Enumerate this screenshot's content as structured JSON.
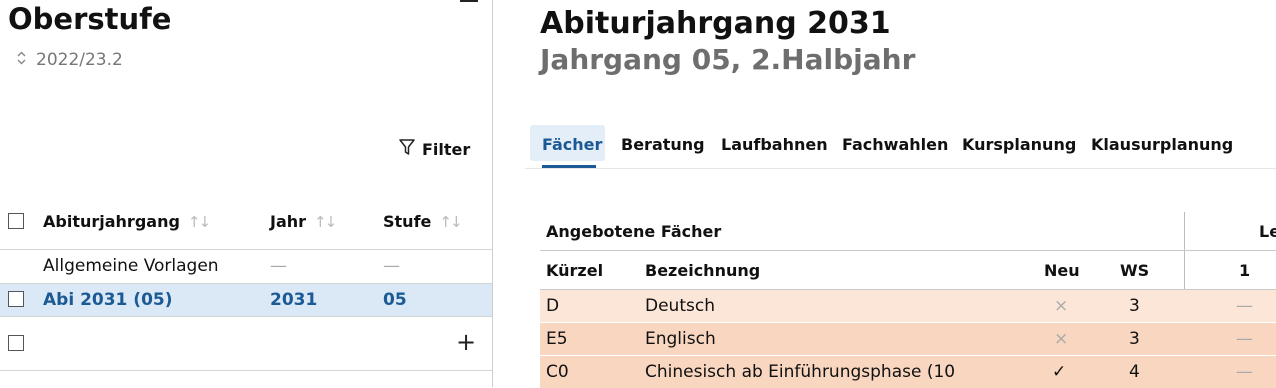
{
  "sidebar": {
    "title": "Oberstufe",
    "term": "2022/23.2",
    "filter_label": "Filter",
    "columns": {
      "abiturjahrgang": "Abiturjahrgang",
      "jahr": "Jahr",
      "stufe": "Stufe"
    },
    "rows": [
      {
        "name": "Allgemeine Vorlagen",
        "jahr": "—",
        "stufe": "—"
      },
      {
        "name": "Abi 2031 (05)",
        "jahr": "2031",
        "stufe": "05"
      }
    ],
    "add_label": "+"
  },
  "main": {
    "title": "Abiturjahrgang 2031",
    "subtitle": "Jahrgang 05, 2.Halbjahr",
    "tabs": [
      "Fächer",
      "Beratung",
      "Laufbahnen",
      "Fachwahlen",
      "Kursplanung",
      "Klausurplanung"
    ],
    "active_tab": "Fächer",
    "table": {
      "group_header": "Angebotene Fächer",
      "group_header_right": "Le",
      "columns": {
        "kuerzel": "Kürzel",
        "bezeichnung": "Bezeichnung",
        "neu": "Neu",
        "ws": "WS",
        "col1": "1"
      },
      "rows": [
        {
          "kuerzel": "D",
          "bezeichnung": "Deutsch",
          "neu": "×",
          "ws": "3",
          "col1": "—"
        },
        {
          "kuerzel": "E5",
          "bezeichnung": "Englisch",
          "neu": "×",
          "ws": "3",
          "col1": "—"
        },
        {
          "kuerzel": "C0",
          "bezeichnung": "Chinesisch ab Einführungsphase (10",
          "neu": "✓",
          "ws": "4",
          "col1": "—"
        }
      ]
    }
  },
  "colors": {
    "accent": "#1b5a94",
    "selected_row": "#dbe9f6",
    "row_orange_light": "#fbe6d8",
    "row_orange": "#f8d6c0"
  }
}
